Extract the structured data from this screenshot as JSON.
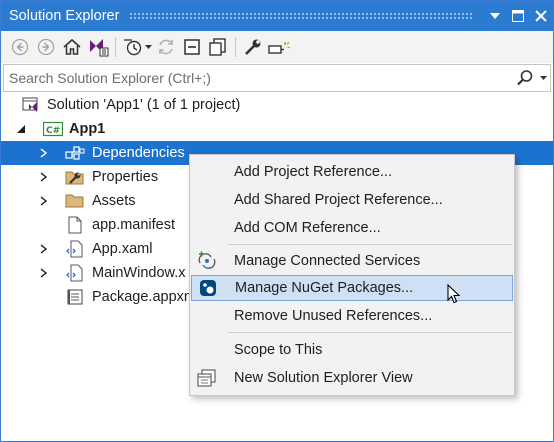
{
  "window": {
    "title": "Solution Explorer",
    "title_buttons": [
      "dropdown-icon",
      "maximize-icon",
      "close-icon"
    ]
  },
  "toolbar": {
    "buttons": [
      "back-icon",
      "forward-icon",
      "home-icon",
      "vs-switch-views-icon",
      "pending-changes-filter-icon",
      "sync-icon",
      "collapse-all-icon",
      "show-all-files-icon",
      "properties-icon",
      "preview-icon"
    ]
  },
  "search": {
    "placeholder": "Search Solution Explorer (Ctrl+;)"
  },
  "tree": {
    "solution": "Solution 'App1' (1 of 1 project)",
    "project": "App1",
    "project_badge": "C#",
    "items": [
      {
        "label": "Dependencies",
        "expandable": true,
        "selected": true,
        "icon": "dependencies-icon"
      },
      {
        "label": "Properties",
        "expandable": true,
        "selected": false,
        "icon": "properties-folder-icon"
      },
      {
        "label": "Assets",
        "expandable": true,
        "selected": false,
        "icon": "folder-icon"
      },
      {
        "label": "app.manifest",
        "expandable": false,
        "selected": false,
        "icon": "manifest-file-icon"
      },
      {
        "label": "App.xaml",
        "expandable": true,
        "selected": false,
        "icon": "xaml-file-icon"
      },
      {
        "label": "MainWindow.x",
        "expandable": true,
        "selected": false,
        "icon": "xaml-file-icon"
      },
      {
        "label": "Package.appxn",
        "expandable": false,
        "selected": false,
        "icon": "package-manifest-icon"
      }
    ]
  },
  "context_menu": {
    "items": [
      {
        "label": "Add Project Reference...",
        "icon": ""
      },
      {
        "label": "Add Shared Project Reference...",
        "icon": ""
      },
      {
        "label": "Add COM Reference...",
        "icon": ""
      },
      {
        "label": "Manage Connected Services",
        "icon": "connected-services-icon"
      },
      {
        "label": "Manage NuGet Packages...",
        "icon": "nuget-icon",
        "hovered": true
      },
      {
        "label": "Remove Unused References...",
        "icon": ""
      },
      {
        "label": "Scope to This",
        "icon": ""
      },
      {
        "label": "New Solution Explorer View",
        "icon": "new-view-icon"
      }
    ]
  },
  "colors": {
    "title_bar": "#2b7bd1",
    "selection": "#1c73cf",
    "menu_hover": "#cfe0f5",
    "menu_hover_border": "#7ba6db",
    "vs_purple": "#68217a",
    "csharp_green": "#388a34"
  }
}
